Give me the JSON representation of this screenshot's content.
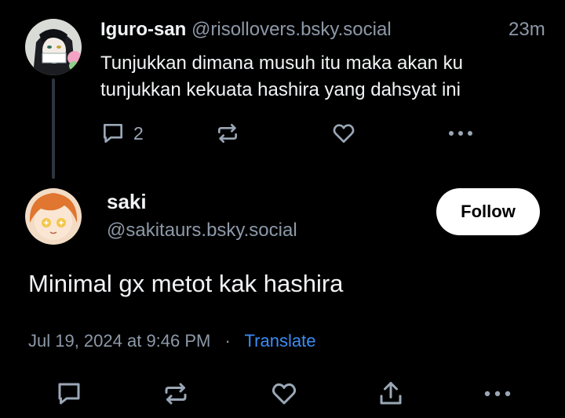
{
  "parent_post": {
    "display_name": "Iguro-san",
    "handle": "@risollovers.bsky.social",
    "time": "23m",
    "text_line1": "Tunjukkan dimana musuh itu maka akan ku",
    "text_line2": "tunjukkan kekuata hashira yang dahsyat ini",
    "reply_count": "2",
    "icons": [
      "reply-icon",
      "repost-icon",
      "like-icon",
      "more-icon"
    ]
  },
  "main_post": {
    "display_name": "saki",
    "handle": "@sakitaurs.bsky.social",
    "follow_label": "Follow",
    "text": "Minimal gx metot kak hashira",
    "timestamp": "Jul 19, 2024 at 9:46 PM",
    "separator": "·",
    "translate_label": "Translate",
    "icons": [
      "reply-icon",
      "repost-icon",
      "like-icon",
      "share-icon",
      "more-icon"
    ]
  },
  "colors": {
    "background": "#000000",
    "text": "#f1f3f5",
    "muted": "#8d99a8",
    "link": "#3b8cf5",
    "thread_line": "#2e3440"
  }
}
